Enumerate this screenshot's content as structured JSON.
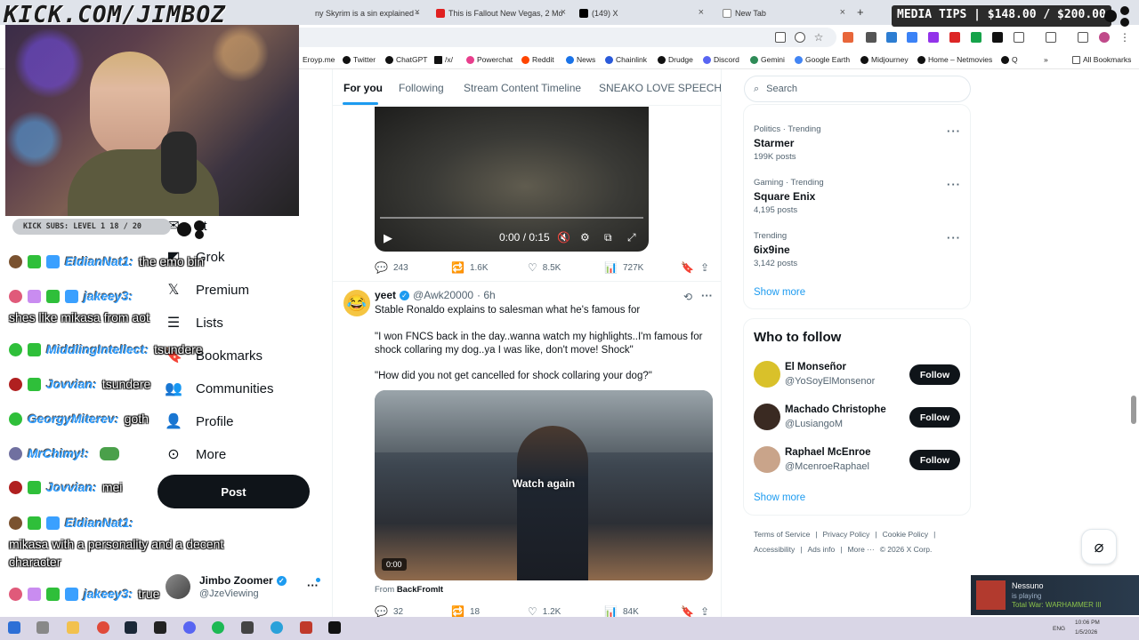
{
  "browser": {
    "tabs": [
      {
        "label": "ny Skyrim is a sin explained -",
        "color": "#5a5a5a"
      },
      {
        "label": "This is Fallout New Vegas, 2 Mo",
        "color": "#e02020"
      },
      {
        "label": "(149) X",
        "color": "#000000"
      },
      {
        "label": "New Tab",
        "color": "#888888"
      }
    ],
    "new_tab": "+",
    "bookmarks": [
      {
        "label": "Eroyp.me",
        "color": "#777"
      },
      {
        "label": "Twitter",
        "color": "#111"
      },
      {
        "label": "ChatGPT",
        "color": "#111"
      },
      {
        "label": "/x/",
        "color": "#111"
      },
      {
        "label": "Powerchat",
        "color": "#e83e8c"
      },
      {
        "label": "Reddit",
        "color": "#ff4500"
      },
      {
        "label": "News",
        "color": "#1a73e8"
      },
      {
        "label": "Chainlink",
        "color": "#2a5ada"
      },
      {
        "label": "Drudge",
        "color": "#111"
      },
      {
        "label": "Discord",
        "color": "#5865f2"
      },
      {
        "label": "Gemini",
        "color": "#2e8b57"
      },
      {
        "label": "Google Earth",
        "color": "#4285f4"
      },
      {
        "label": "Midjourney",
        "color": "#111"
      },
      {
        "label": "Home – Netmovies",
        "color": "#111"
      },
      {
        "label": "Q",
        "color": "#111"
      }
    ],
    "all_bookmarks": "All Bookmarks"
  },
  "overlay": {
    "title": "KICK.COM/JIMBOZ",
    "media_tips": "MEDIA TIPS | $148.00 / $200.00",
    "subs_bar": "KICK SUBS: LEVEL 1 18 / 20"
  },
  "chat": [
    {
      "user": "EldianNat1:",
      "msg": "the emo bin",
      "badge": "#7a5230"
    },
    {
      "user": "jakeey3:",
      "msg": "shes like mikasa from aot",
      "badge": "#e05a7a"
    },
    {
      "user": "MiddlingIntellect:",
      "msg": "tsundere",
      "badge": "#2fbf3a"
    },
    {
      "user": "Jovvian:",
      "msg": "tsundere",
      "badge": "#b02020"
    },
    {
      "user": "GeorgyMiterev:",
      "msg": "goth",
      "badge": "#2fbf3a"
    },
    {
      "user": "MrChimy!:",
      "msg": "",
      "badge": "#7070a0"
    },
    {
      "user": "Jovvian:",
      "msg": "mei",
      "badge": "#b02020"
    },
    {
      "user": "EldianNat1:",
      "msg": "mikasa with a personality and a decent character",
      "badge": "#7a5230"
    },
    {
      "user": "jakeey3:",
      "msg": "true",
      "badge": "#e05a7a"
    }
  ],
  "sidebar": {
    "items": [
      {
        "label": "at",
        "icon": "chat-icon"
      },
      {
        "label": "Grok",
        "icon": "grok-icon"
      },
      {
        "label": "Premium",
        "icon": "x-logo-icon"
      },
      {
        "label": "Lists",
        "icon": "list-icon"
      },
      {
        "label": "Bookmarks",
        "icon": "bookmark-icon"
      },
      {
        "label": "Communities",
        "icon": "communities-icon"
      },
      {
        "label": "Profile",
        "icon": "profile-icon"
      },
      {
        "label": "More",
        "icon": "more-icon"
      }
    ],
    "post_label": "Post",
    "account_name": "Jimbo Zoomer",
    "account_handle": "@JzeViewing",
    "account_more": "···"
  },
  "timeline": {
    "tabs": [
      "For you",
      "Following",
      "Stream Content Timeline",
      "SNEAKO LOVE SPEECH"
    ],
    "tweet1": {
      "video_time": "0:00 / 0:15",
      "replies": "243",
      "reposts": "1.6K",
      "likes": "8.5K",
      "views": "727K"
    },
    "tweet2": {
      "name": "yeet",
      "handle": "@Awk20000",
      "time": "· 6h",
      "text1": "Stable Ronaldo explains to salesman what he's famous for",
      "text2": "\"I won FNCS back in the day..wanna watch my highlights..I'm famous for shock collaring my dog..ya I was like, don't move! Shock\"",
      "text3": "\"How did you not get cancelled for shock collaring your dog?\"",
      "watch_again": "Watch again",
      "video_time": "0:00",
      "from_prefix": "From",
      "from_source": "BackFromIt",
      "replies": "32",
      "reposts": "18",
      "likes": "1.2K",
      "views": "84K"
    }
  },
  "right": {
    "search_placeholder": "Search",
    "trends": [
      {
        "meta": "Politics · Trending",
        "name": "Starmer",
        "count": "199K posts"
      },
      {
        "meta": "Gaming · Trending",
        "name": "Square Enix",
        "count": "4,195 posts"
      },
      {
        "meta": "Trending",
        "name": "6ix9ine",
        "count": "3,142 posts"
      }
    ],
    "show_more": "Show more",
    "who_to_follow": "Who to follow",
    "suggestions": [
      {
        "name": "El Monseñor",
        "handle": "@YoSoyElMonsenor",
        "color": "#d9c12a"
      },
      {
        "name": "Machado Christophe",
        "handle": "@LusiangoM",
        "color": "#3a2a22"
      },
      {
        "name": "Raphael McEnroe",
        "handle": "@McenroeRaphael",
        "color": "#c9a48a"
      }
    ],
    "follow_label": "Follow",
    "footer_row1": [
      "Terms of Service",
      "|",
      "Privacy Policy",
      "|",
      "Cookie Policy",
      "|"
    ],
    "footer_row2": [
      "Accessibility",
      "|",
      "Ads info",
      "|",
      "More ···",
      "© 2026 X Corp."
    ]
  },
  "steam": {
    "name": "Nessuno",
    "status": "is playing",
    "game": "Total War: WARHAMMER III"
  },
  "taskbar": {
    "lang": "ENG",
    "time": "10:06 PM",
    "date": "1/5/2026"
  }
}
